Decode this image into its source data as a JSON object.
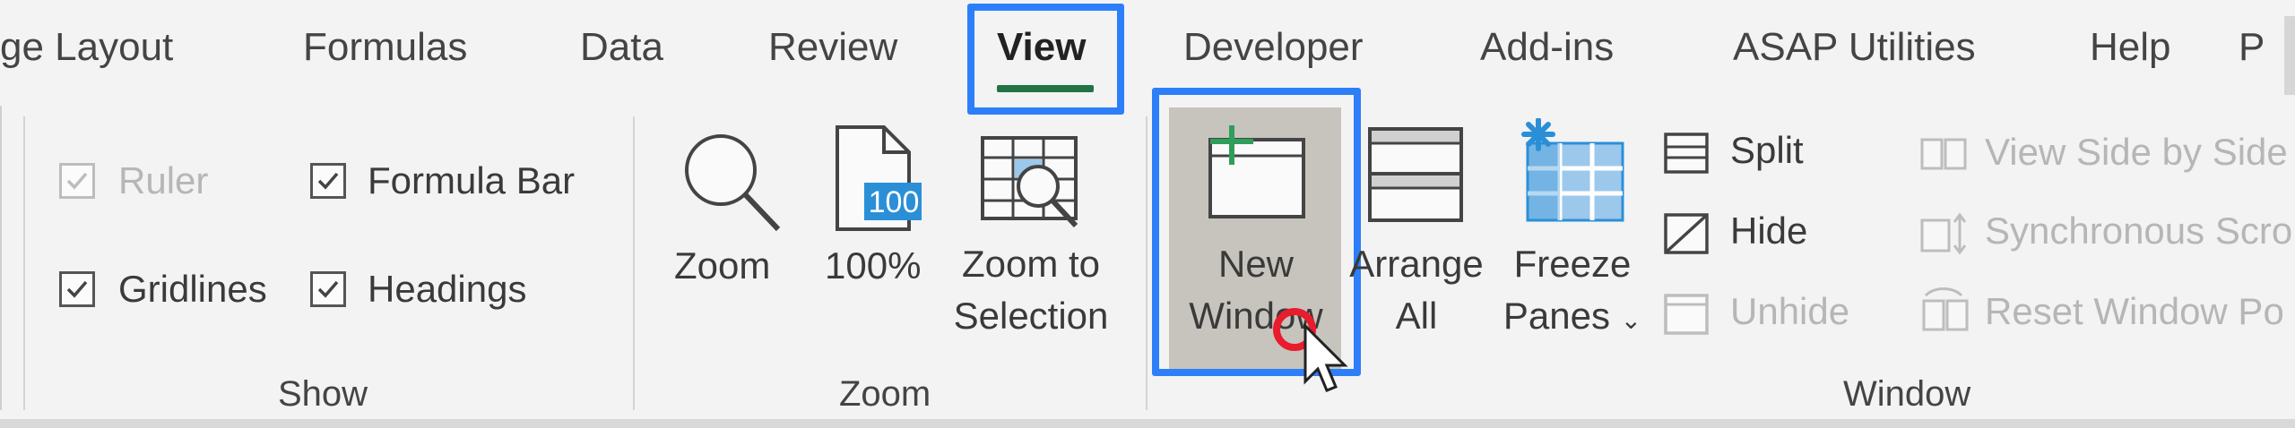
{
  "tabs": {
    "page_layout": "ge Layout",
    "formulas": "Formulas",
    "data": "Data",
    "review": "Review",
    "view": "View",
    "developer": "Developer",
    "addins": "Add-ins",
    "asap": "ASAP Utilities",
    "help": "Help",
    "p": "P"
  },
  "show": {
    "ruler": "Ruler",
    "formula_bar": "Formula Bar",
    "gridlines": "Gridlines",
    "headings": "Headings",
    "group_label": "Show"
  },
  "zoom": {
    "zoom": "Zoom",
    "hundred": "100%",
    "hundred_icon_text": "100",
    "zoom_to_selection_1": "Zoom to",
    "zoom_to_selection_2": "Selection",
    "group_label": "Zoom"
  },
  "window": {
    "new_window_1": "New",
    "new_window_2": "Window",
    "arrange_1": "Arrange",
    "arrange_2": "All",
    "freeze_1": "Freeze",
    "freeze_2": "Panes",
    "split": "Split",
    "hide": "Hide",
    "unhide": "Unhide",
    "side_by_side": "View Side by Side",
    "synchronous": "Synchronous Scro",
    "reset": "Reset Window Po",
    "group_label": "Window"
  },
  "colors": {
    "highlight": "#2d7ff9",
    "tab_underline": "#217346",
    "icon_blue": "#2b8fd8",
    "icon_green": "#2f9e5b",
    "cursor_red": "#e81c2c"
  }
}
